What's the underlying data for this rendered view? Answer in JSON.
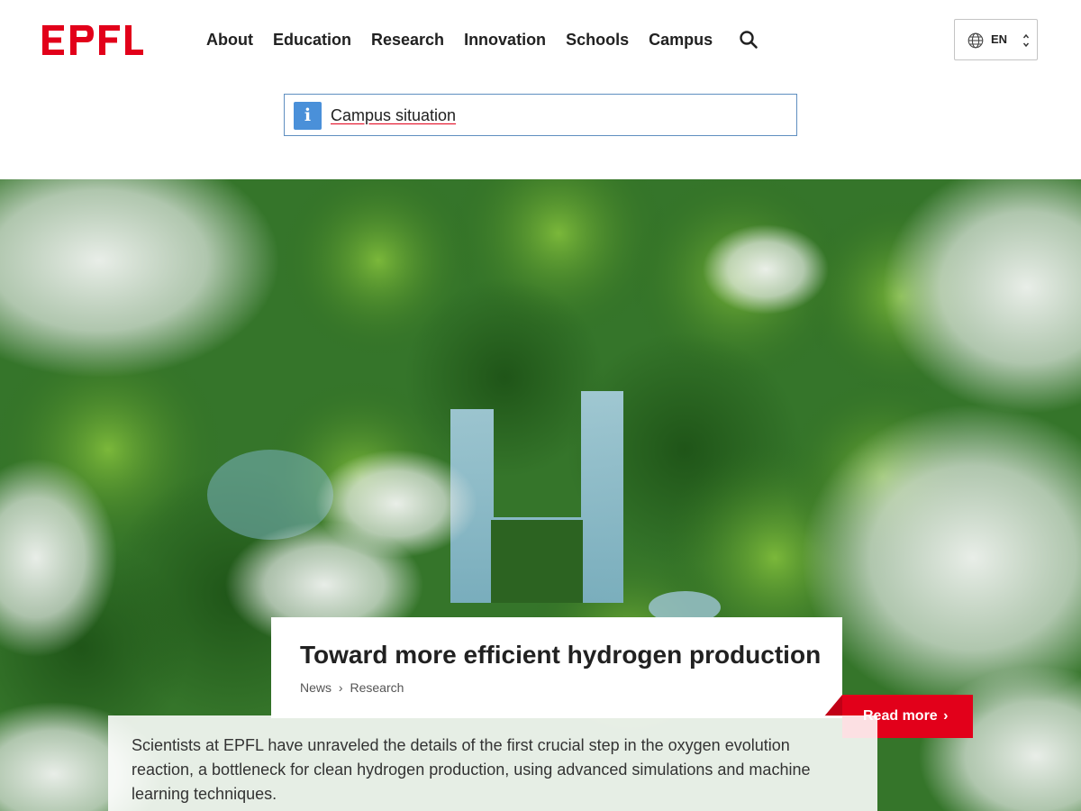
{
  "header": {
    "logo_text": "EPFL",
    "nav": [
      {
        "label": "About"
      },
      {
        "label": "Education"
      },
      {
        "label": "Research"
      },
      {
        "label": "Innovation"
      },
      {
        "label": "Schools"
      },
      {
        "label": "Campus"
      }
    ],
    "search_icon": "search-icon",
    "language": {
      "code": "EN",
      "icon": "globe-icon"
    }
  },
  "alert": {
    "icon": "info-icon",
    "icon_glyph": "i",
    "link_text": "Campus situation"
  },
  "hero": {
    "image": "aerial-forest-lake-H-shape",
    "title": "Toward more efficient hydrogen production",
    "breadcrumb": {
      "category": "News",
      "separator": "›",
      "subcategory": "Research"
    },
    "description": "Scientists at EPFL have unraveled the details of the first crucial step in the oxygen evolution reaction, a bottleneck for clean hydrogen production, using advanced simulations and machine learning techniques.",
    "cta_label": "Read more",
    "cta_chevron": "›"
  },
  "colors": {
    "brand_red": "#e2001a",
    "text": "#212121",
    "info_blue": "#4a90d9",
    "alert_border": "#5f8fc0"
  }
}
